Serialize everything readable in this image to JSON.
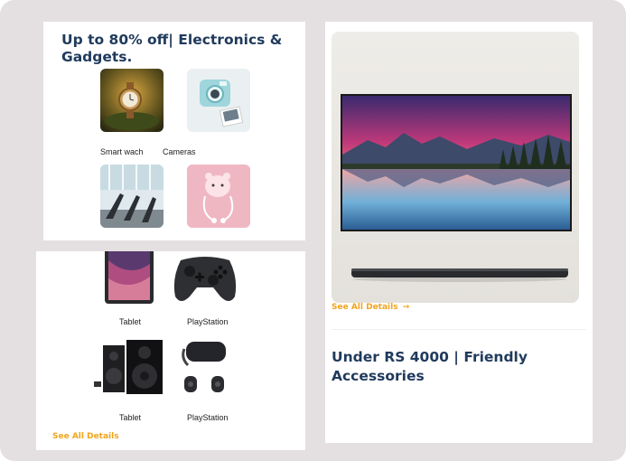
{
  "cards": {
    "electronics": {
      "title": "Up to 80% off| Electronics & Gadgets.",
      "items": [
        {
          "label": "Smart wach",
          "image": "watch-image"
        },
        {
          "label": "Cameras",
          "image": "camera-image"
        },
        {
          "label": "",
          "image": "gym-image"
        },
        {
          "label": "",
          "image": "earphones-image"
        }
      ]
    },
    "gaming": {
      "items": [
        {
          "label": "Tablet",
          "image": "tablet-image"
        },
        {
          "label": "PlayStation",
          "image": "gamepad-image"
        },
        {
          "label": "Tablet",
          "image": "speakers-image"
        },
        {
          "label": "PlayStation",
          "image": "vr-headset-image"
        }
      ],
      "see_all": "See All Details"
    },
    "accessories": {
      "image": "wall-tv-image",
      "see_all": "See All Details",
      "arrow_icon": "arrow-right-icon",
      "title": "Under RS 4000 | Friendly Accessories"
    }
  },
  "colors": {
    "background": "#e4dfe0",
    "title": "#1f3a5c",
    "link": "#f0a41c"
  }
}
